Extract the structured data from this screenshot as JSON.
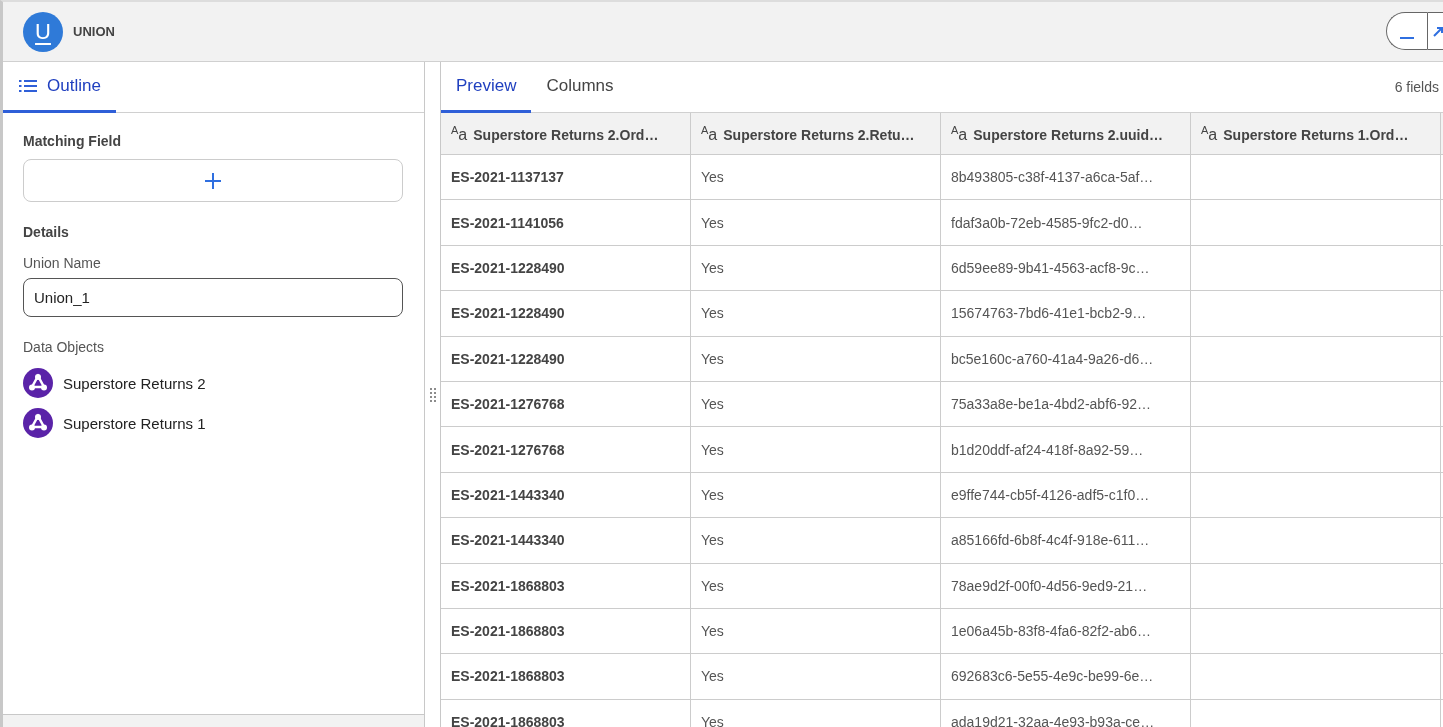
{
  "header": {
    "title": "UNION",
    "logo_letter": "U"
  },
  "sidebar": {
    "tabs": [
      {
        "label": "Outline",
        "selected": true
      }
    ],
    "matching_field": {
      "label": "Matching Field"
    },
    "details": {
      "label": "Details",
      "union_name_label": "Union Name",
      "union_name": "Union_1"
    },
    "data_objects": {
      "label": "Data Objects",
      "items": [
        {
          "name": "Superstore Returns 2"
        },
        {
          "name": "Superstore Returns 1"
        }
      ]
    }
  },
  "main": {
    "tabs": [
      {
        "label": "Preview",
        "selected": true
      },
      {
        "label": "Columns",
        "selected": false
      }
    ],
    "field_count": "6 fields",
    "table": {
      "columns": [
        {
          "type_icon": "$^{A}$a",
          "title": "Superstore Returns 2.Ord…"
        },
        {
          "type_icon": "$^{A}$a",
          "title": "Superstore Returns 2.Retu…"
        },
        {
          "type_icon": "$^{A}$a",
          "title": "Superstore Returns 2.uuid…"
        },
        {
          "type_icon": "$^{A}$a",
          "title": "Superstore Returns 1.Ord…"
        }
      ],
      "rows": [
        [
          "ES-2021-1137137",
          "Yes",
          "8b493805-c38f-4137-a6ca-5af…"
        ],
        [
          "ES-2021-1141056",
          "Yes",
          "fdaf3a0b-72eb-4585-9fc2-d0…"
        ],
        [
          "ES-2021-1228490",
          "Yes",
          "6d59ee89-9b41-4563-acf8-9c…"
        ],
        [
          "ES-2021-1228490",
          "Yes",
          "15674763-7bd6-41e1-bcb2-9…"
        ],
        [
          "ES-2021-1228490",
          "Yes",
          "bc5e160c-a760-41a4-9a26-d6…"
        ],
        [
          "ES-2021-1276768",
          "Yes",
          "75a33a8e-be1a-4bd2-abf6-92…"
        ],
        [
          "ES-2021-1276768",
          "Yes",
          "b1d20ddf-af24-418f-8a92-59…"
        ],
        [
          "ES-2021-1443340",
          "Yes",
          "e9ffe744-cb5f-4126-adf5-c1f0…"
        ],
        [
          "ES-2021-1443340",
          "Yes",
          "a85166fd-6b8f-4c4f-918e-611…"
        ],
        [
          "ES-2021-1868803",
          "Yes",
          "78ae9d2f-00f0-4d56-9ed9-21…"
        ],
        [
          "ES-2021-1868803",
          "Yes",
          "1e06a45b-83f8-4fa6-82f2-ab6…"
        ],
        [
          "ES-2021-1868803",
          "Yes",
          "692683c6-5e55-4e9c-be99-6e…"
        ],
        [
          "ES-2021-1868803",
          "Yes",
          "ada19d21-32aa-4e93-b93a-ce…"
        ]
      ]
    }
  }
}
